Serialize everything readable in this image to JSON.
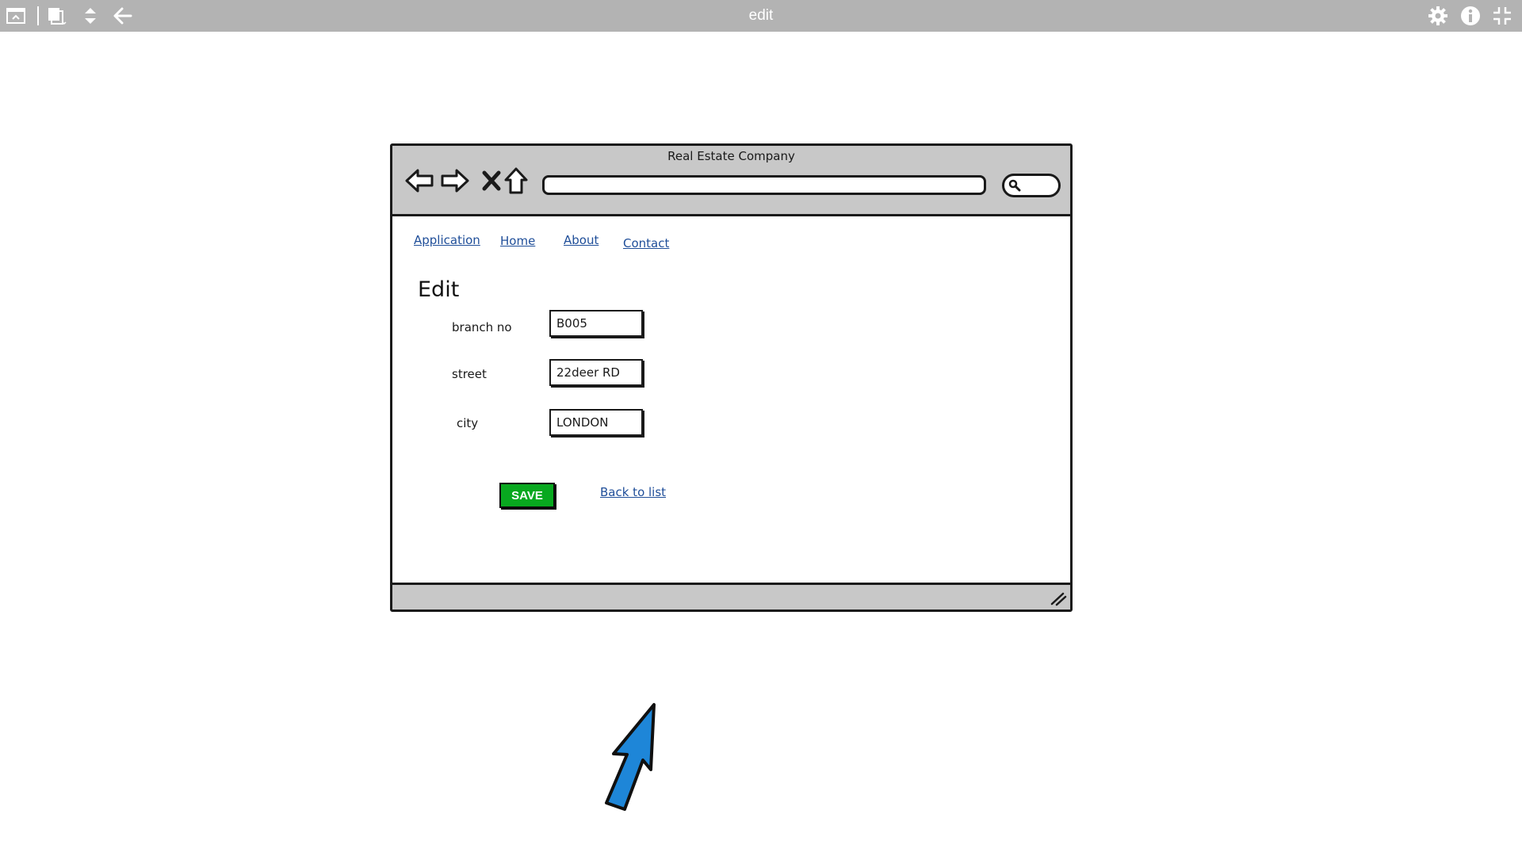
{
  "app": {
    "title": "edit",
    "toolbar_icons": [
      "window-icon",
      "pages-icon",
      "sort-icon",
      "back-arrow-icon"
    ],
    "right_icons": [
      "gear-icon",
      "info-icon",
      "collapse-icon"
    ]
  },
  "browser": {
    "window_title": "Real Estate Company",
    "address_value": "",
    "nav_buttons": [
      "back-icon",
      "forward-icon",
      "stop-icon",
      "home-icon"
    ]
  },
  "nav": {
    "links": [
      "Application",
      "Home",
      "About",
      "Contact"
    ]
  },
  "form": {
    "heading": "Edit",
    "fields": [
      {
        "label": "branch no",
        "value": "B005"
      },
      {
        "label": "street",
        "value": "22deer RD"
      },
      {
        "label": "city",
        "value": "LONDON"
      }
    ],
    "save_label": "SAVE",
    "back_link": "Back to list"
  },
  "colors": {
    "topbar": "#b3b3b3",
    "chrome": "#c8c8c8",
    "link": "#1f4e99",
    "save_button": "#08a81f",
    "cursor_fill": "#1e86d8"
  }
}
